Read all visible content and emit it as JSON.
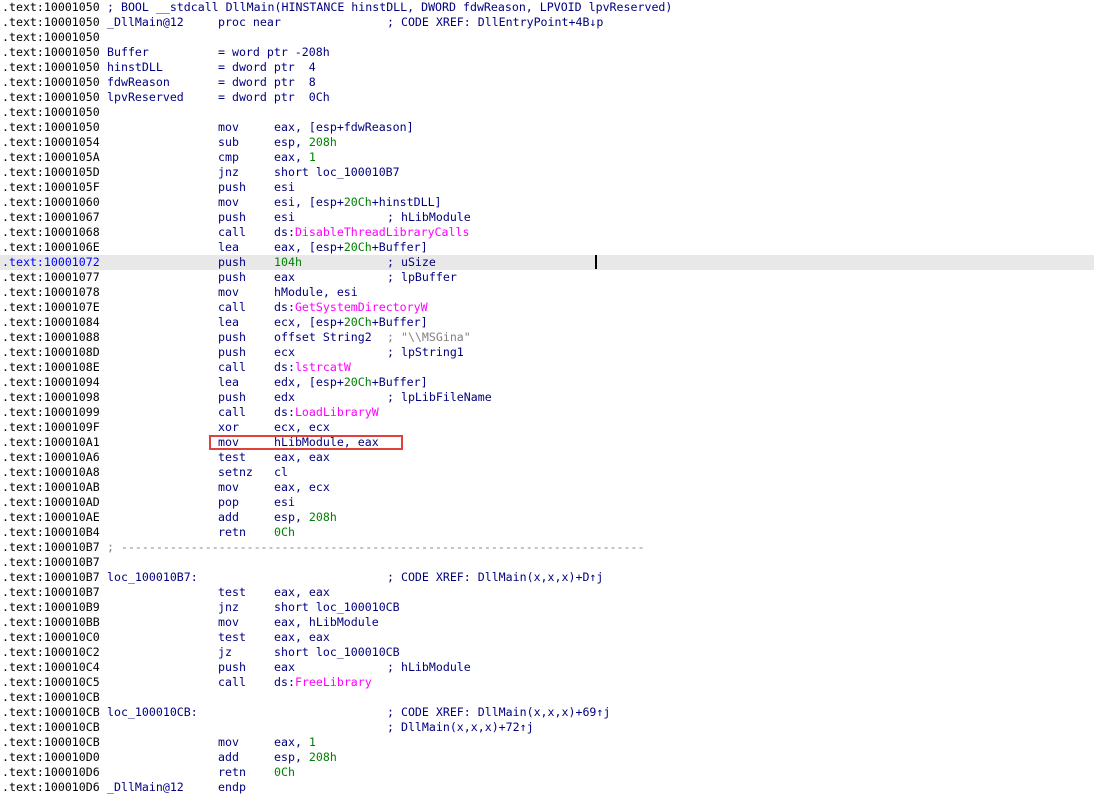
{
  "window": {
    "app": "IDA disassembly listing",
    "function_name": "_DllMain@12"
  },
  "listing": {
    "lines": [
      {
        "addr": ".text:10001050",
        "header": [
          {
            "t": "; BOOL __stdcall DllMain(HINSTANCE hinstDLL, DWORD fdwReason, LPVOID lpvReserved)",
            "c": ""
          }
        ]
      },
      {
        "addr": ".text:10001050",
        "label": "_DllMain@12",
        "mnem": "proc near",
        "comment": [
          {
            "t": "; CODE XREF: DllEntryPoint+4B↓p",
            "c": ""
          }
        ]
      },
      {
        "addr": ".text:10001050"
      },
      {
        "addr": ".text:10001050",
        "label": "Buffer",
        "mnem": "= word ptr -208h"
      },
      {
        "addr": ".text:10001050",
        "label": "hinstDLL",
        "mnem": "= dword ptr  4"
      },
      {
        "addr": ".text:10001050",
        "label": "fdwReason",
        "mnem": "= dword ptr  8"
      },
      {
        "addr": ".text:10001050",
        "label": "lpvReserved",
        "mnem": "= dword ptr  0Ch"
      },
      {
        "addr": ".text:10001050"
      },
      {
        "addr": ".text:10001050",
        "mnem": "mov",
        "ops": [
          {
            "t": "eax, [esp+fdwReason]",
            "c": ""
          }
        ]
      },
      {
        "addr": ".text:10001054",
        "mnem": "sub",
        "ops": [
          {
            "t": "esp, ",
            "c": ""
          },
          {
            "t": "208h",
            "c": "num"
          }
        ]
      },
      {
        "addr": ".text:1000105A",
        "mnem": "cmp",
        "ops": [
          {
            "t": "eax, ",
            "c": ""
          },
          {
            "t": "1",
            "c": "num"
          }
        ]
      },
      {
        "addr": ".text:1000105D",
        "mnem": "jnz",
        "ops": [
          {
            "t": "short loc_100010B7",
            "c": ""
          }
        ]
      },
      {
        "addr": ".text:1000105F",
        "mnem": "push",
        "ops": [
          {
            "t": "esi",
            "c": ""
          }
        ]
      },
      {
        "addr": ".text:10001060",
        "mnem": "mov",
        "ops": [
          {
            "t": "esi, [esp+",
            "c": ""
          },
          {
            "t": "20Ch",
            "c": "num"
          },
          {
            "t": "+hinstDLL]",
            "c": ""
          }
        ]
      },
      {
        "addr": ".text:10001067",
        "mnem": "push",
        "ops": [
          {
            "t": "esi",
            "c": ""
          }
        ],
        "comment": [
          {
            "t": "; hLibModule",
            "c": ""
          }
        ]
      },
      {
        "addr": ".text:10001068",
        "mnem": "call",
        "ops": [
          {
            "t": "ds:",
            "c": ""
          },
          {
            "t": "DisableThreadLibraryCalls",
            "c": "imp"
          }
        ]
      },
      {
        "addr": ".text:1000106E",
        "mnem": "lea",
        "ops": [
          {
            "t": "eax, [esp+",
            "c": ""
          },
          {
            "t": "20Ch",
            "c": "num"
          },
          {
            "t": "+Buffer]",
            "c": ""
          }
        ]
      },
      {
        "addr": ".text:10001072",
        "current": true,
        "mnem": "push",
        "ops": [
          {
            "t": "104h",
            "c": "num"
          }
        ],
        "comment": [
          {
            "t": "; uSize",
            "c": ""
          }
        ]
      },
      {
        "addr": ".text:10001077",
        "mnem": "push",
        "ops": [
          {
            "t": "eax",
            "c": ""
          }
        ],
        "comment": [
          {
            "t": "; lpBuffer",
            "c": ""
          }
        ]
      },
      {
        "addr": ".text:10001078",
        "mnem": "mov",
        "ops": [
          {
            "t": "hModule, esi",
            "c": ""
          }
        ]
      },
      {
        "addr": ".text:1000107E",
        "mnem": "call",
        "ops": [
          {
            "t": "ds:",
            "c": ""
          },
          {
            "t": "GetSystemDirectoryW",
            "c": "imp"
          }
        ]
      },
      {
        "addr": ".text:10001084",
        "mnem": "lea",
        "ops": [
          {
            "t": "ecx, [esp+",
            "c": ""
          },
          {
            "t": "20Ch",
            "c": "num"
          },
          {
            "t": "+Buffer]",
            "c": ""
          }
        ]
      },
      {
        "addr": ".text:10001088",
        "mnem": "push",
        "ops": [
          {
            "t": "offset String2",
            "c": ""
          }
        ],
        "comment": [
          {
            "t": "; \"\\\\MSGina\"",
            "c": "str"
          }
        ]
      },
      {
        "addr": ".text:1000108D",
        "mnem": "push",
        "ops": [
          {
            "t": "ecx",
            "c": ""
          }
        ],
        "comment": [
          {
            "t": "; lpString1",
            "c": ""
          }
        ]
      },
      {
        "addr": ".text:1000108E",
        "mnem": "call",
        "ops": [
          {
            "t": "ds:",
            "c": ""
          },
          {
            "t": "lstrcatW",
            "c": "imp"
          }
        ]
      },
      {
        "addr": ".text:10001094",
        "mnem": "lea",
        "ops": [
          {
            "t": "edx, [esp+",
            "c": ""
          },
          {
            "t": "20Ch",
            "c": "num"
          },
          {
            "t": "+Buffer]",
            "c": ""
          }
        ]
      },
      {
        "addr": ".text:10001098",
        "mnem": "push",
        "ops": [
          {
            "t": "edx",
            "c": ""
          }
        ],
        "comment": [
          {
            "t": "; lpLibFileName",
            "c": ""
          }
        ]
      },
      {
        "addr": ".text:10001099",
        "mnem": "call",
        "ops": [
          {
            "t": "ds:",
            "c": ""
          },
          {
            "t": "LoadLibraryW",
            "c": "imp"
          }
        ]
      },
      {
        "addr": ".text:1000109F",
        "mnem": "xor",
        "ops": [
          {
            "t": "ecx, ecx",
            "c": ""
          }
        ]
      },
      {
        "addr": ".text:100010A1",
        "highlight": true,
        "mnem": "mov",
        "ops": [
          {
            "t": "hLibModule, eax",
            "c": ""
          }
        ]
      },
      {
        "addr": ".text:100010A6",
        "mnem": "test",
        "ops": [
          {
            "t": "eax, eax",
            "c": ""
          }
        ]
      },
      {
        "addr": ".text:100010A8",
        "mnem": "setnz",
        "ops": [
          {
            "t": "cl",
            "c": ""
          }
        ]
      },
      {
        "addr": ".text:100010AB",
        "mnem": "mov",
        "ops": [
          {
            "t": "eax, ecx",
            "c": ""
          }
        ]
      },
      {
        "addr": ".text:100010AD",
        "mnem": "pop",
        "ops": [
          {
            "t": "esi",
            "c": ""
          }
        ]
      },
      {
        "addr": ".text:100010AE",
        "mnem": "add",
        "ops": [
          {
            "t": "esp, ",
            "c": ""
          },
          {
            "t": "208h",
            "c": "num"
          }
        ]
      },
      {
        "addr": ".text:100010B4",
        "mnem": "retn",
        "ops": [
          {
            "t": "0Ch",
            "c": "num"
          }
        ]
      },
      {
        "addr": ".text:100010B7",
        "separator": "; ---------------------------------------------------------------------------"
      },
      {
        "addr": ".text:100010B7"
      },
      {
        "addr": ".text:100010B7",
        "label": "loc_100010B7:",
        "comment": [
          {
            "t": "; CODE XREF: DllMain(x,x,x)+D↑j",
            "c": ""
          }
        ]
      },
      {
        "addr": ".text:100010B7",
        "mnem": "test",
        "ops": [
          {
            "t": "eax, eax",
            "c": ""
          }
        ]
      },
      {
        "addr": ".text:100010B9",
        "mnem": "jnz",
        "ops": [
          {
            "t": "short loc_100010CB",
            "c": ""
          }
        ]
      },
      {
        "addr": ".text:100010BB",
        "mnem": "mov",
        "ops": [
          {
            "t": "eax, hLibModule",
            "c": ""
          }
        ]
      },
      {
        "addr": ".text:100010C0",
        "mnem": "test",
        "ops": [
          {
            "t": "eax, eax",
            "c": ""
          }
        ]
      },
      {
        "addr": ".text:100010C2",
        "mnem": "jz",
        "ops": [
          {
            "t": "short loc_100010CB",
            "c": ""
          }
        ]
      },
      {
        "addr": ".text:100010C4",
        "mnem": "push",
        "ops": [
          {
            "t": "eax",
            "c": ""
          }
        ],
        "comment": [
          {
            "t": "; hLibModule",
            "c": ""
          }
        ]
      },
      {
        "addr": ".text:100010C5",
        "mnem": "call",
        "ops": [
          {
            "t": "ds:",
            "c": ""
          },
          {
            "t": "FreeLibrary",
            "c": "imp"
          }
        ]
      },
      {
        "addr": ".text:100010CB"
      },
      {
        "addr": ".text:100010CB",
        "label": "loc_100010CB:",
        "comment": [
          {
            "t": "; CODE XREF: DllMain(x,x,x)+69↑j",
            "c": ""
          }
        ]
      },
      {
        "addr": ".text:100010CB",
        "comment": [
          {
            "t": "; DllMain(x,x,x)+72↑j",
            "c": ""
          }
        ]
      },
      {
        "addr": ".text:100010CB",
        "mnem": "mov",
        "ops": [
          {
            "t": "eax, ",
            "c": ""
          },
          {
            "t": "1",
            "c": "num"
          }
        ]
      },
      {
        "addr": ".text:100010D0",
        "mnem": "add",
        "ops": [
          {
            "t": "esp, ",
            "c": ""
          },
          {
            "t": "208h",
            "c": "num"
          }
        ]
      },
      {
        "addr": ".text:100010D6",
        "mnem": "retn",
        "ops": [
          {
            "t": "0Ch",
            "c": "num"
          }
        ]
      },
      {
        "addr": ".text:100010D6",
        "label": "_DllMain@12",
        "mnem": "endp"
      }
    ]
  },
  "colors": {
    "background": "#ffffff",
    "code_text": "#000080",
    "address_text": "#000000",
    "current_address": "#0000ff",
    "current_line_bg": "#e8e8e8",
    "number": "#008000",
    "import_name": "#ff00ff",
    "string_comment": "#808080",
    "highlight_box": "#e0413a"
  }
}
